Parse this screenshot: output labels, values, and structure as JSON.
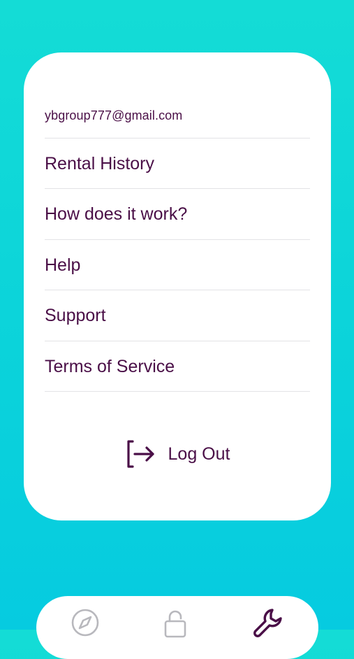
{
  "account": {
    "email": "ybgroup777@gmail.com"
  },
  "menu": {
    "items": [
      {
        "label": "Rental History"
      },
      {
        "label": "How does it work?"
      },
      {
        "label": "Help"
      },
      {
        "label": "Support"
      },
      {
        "label": "Terms of Service"
      }
    ]
  },
  "logout": {
    "label": "Log Out",
    "icon": "logout-icon"
  },
  "tabbar": {
    "tabs": [
      {
        "icon": "compass-icon",
        "active": false
      },
      {
        "icon": "unlock-icon",
        "active": false
      },
      {
        "icon": "wrench-icon",
        "active": true
      }
    ]
  },
  "colors": {
    "background_top": "#14dcd6",
    "background_bottom": "#06cbe0",
    "text": "#4a0f47",
    "divider": "#e3e3e6",
    "inactive_icon": "#b8b8bd"
  }
}
